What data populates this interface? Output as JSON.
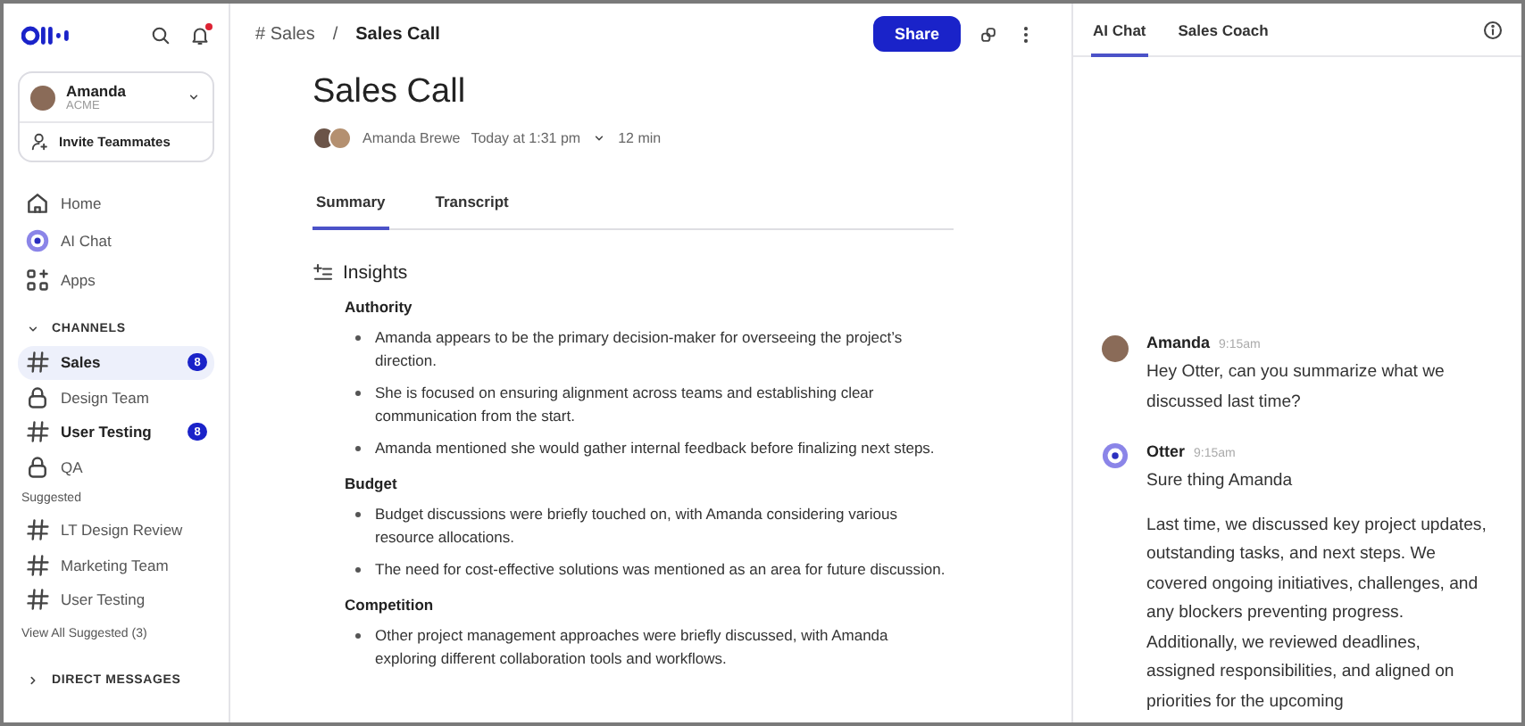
{
  "sidebar": {
    "account": {
      "name": "Amanda",
      "org": "ACME",
      "invite": "Invite Teammates"
    },
    "nav": [
      {
        "label": "Home",
        "kind": "home"
      },
      {
        "label": "AI Chat",
        "kind": "ai"
      },
      {
        "label": "Apps",
        "kind": "apps"
      }
    ],
    "channels": {
      "title": "CHANNELS",
      "expanded": true,
      "items": [
        {
          "label": "Sales",
          "kind": "hash",
          "selected": true,
          "unread": true,
          "badge": "8"
        },
        {
          "label": "Design Team",
          "kind": "lock",
          "selected": false,
          "unread": false
        },
        {
          "label": "User Testing",
          "kind": "hash",
          "selected": false,
          "unread": true,
          "badge": "8"
        },
        {
          "label": "QA",
          "kind": "lock",
          "selected": false,
          "unread": false
        }
      ]
    },
    "suggested": {
      "title": "Suggested",
      "items": [
        {
          "label": "LT Design Review",
          "kind": "hash"
        },
        {
          "label": "Marketing Team",
          "kind": "hash"
        },
        {
          "label": "User Testing",
          "kind": "hash"
        }
      ],
      "more": "View All Suggested (3)"
    },
    "sections": [
      {
        "title": "DIRECT MESSAGES",
        "expanded": false
      }
    ]
  },
  "header": {
    "breadcrumb": [
      "# Sales",
      "Sales Call"
    ],
    "separator": "/",
    "share": "Share"
  },
  "meeting": {
    "title": "Sales Call",
    "owner": "Amanda Brewe",
    "time": "Today at 1:31 pm",
    "duration": "12 min",
    "tabs": [
      {
        "label": "Summary",
        "selected": true
      },
      {
        "label": "Transcript",
        "selected": false
      }
    ],
    "insights_title": "Insights",
    "groups": [
      {
        "heading": "Authority",
        "bullets": [
          "Amanda appears to be the primary decision-maker for overseeing the project’s direction.",
          "She is focused on ensuring alignment across teams and establishing clear communication from the start.",
          "Amanda mentioned she would gather internal feedback before finalizing next steps."
        ]
      },
      {
        "heading": "Budget",
        "bullets": [
          "Budget discussions were briefly touched on, with Amanda considering various resource allocations.",
          "The need for cost-effective solutions was mentioned as an area for future discussion."
        ]
      },
      {
        "heading": "Competition",
        "bullets": [
          "Other project management approaches were briefly discussed, with Amanda exploring different collaboration tools and workflows."
        ]
      }
    ]
  },
  "chat": {
    "tabs": [
      {
        "label": "AI Chat",
        "selected": true
      },
      {
        "label": "Sales Coach",
        "selected": false
      }
    ],
    "messages": [
      {
        "author": "Amanda",
        "kind": "user",
        "time": "9:15am",
        "paragraphs": [
          "Hey Otter, can you summarize what we discussed last time?"
        ]
      },
      {
        "author": "Otter",
        "kind": "bot",
        "time": "9:15am",
        "paragraphs": [
          "Sure thing Amanda",
          "Last time, we discussed key project updates, outstanding tasks, and next steps. We covered ongoing initiatives, challenges, and any blockers preventing progress. Additionally, we reviewed deadlines, assigned responsibilities, and aligned on priorities for the upcoming"
        ]
      }
    ]
  }
}
